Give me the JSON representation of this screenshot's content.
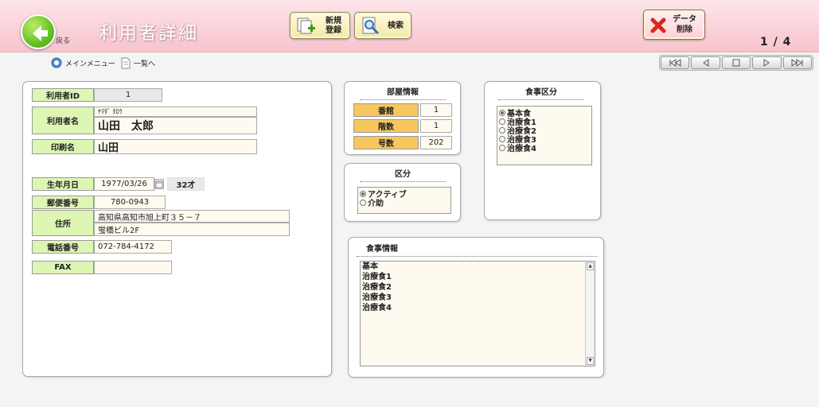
{
  "header": {
    "back_label": "戻る",
    "title": "利用者詳細",
    "new_button": [
      "新規",
      "登録"
    ],
    "search_button": "検索",
    "delete_button": [
      "データ",
      "削除"
    ],
    "page_counter": "1 / 4"
  },
  "subnav": {
    "main_menu": "メインメニュー",
    "list": "一覧へ"
  },
  "user": {
    "id_label": "利用者ID",
    "id_value": "1",
    "name_label": "利用者名",
    "name_kana": "ﾔﾏﾀﾞ ﾀﾛｳ",
    "name_value": "山田　太郎",
    "print_label": "印刷名",
    "print_value": "山田",
    "birth_label": "生年月日",
    "birth_value": "1977/03/26",
    "age_value": "32才",
    "zip_label": "郵便番号",
    "zip_value": "780-0943",
    "address_label": "住所",
    "address_line1": "高知県高知市旭上町３５－７",
    "address_line2": "蛍橋ビル2F",
    "phone_label": "電話番号",
    "phone_value": "072-784-4172",
    "fax_label": "FAX",
    "fax_value": ""
  },
  "room": {
    "title": "部屋情報",
    "building_label": "番館",
    "building_value": "1",
    "floor_label": "階数",
    "floor_value": "1",
    "number_label": "号数",
    "number_value": "202"
  },
  "category": {
    "title": "区分",
    "options": [
      {
        "label": "アクティブ",
        "selected": true
      },
      {
        "label": "介助",
        "selected": false
      }
    ]
  },
  "meal_type": {
    "title": "食事区分",
    "options": [
      {
        "label": "基本食",
        "selected": true
      },
      {
        "label": "治療食1",
        "selected": false
      },
      {
        "label": "治療食2",
        "selected": false
      },
      {
        "label": "治療食3",
        "selected": false
      },
      {
        "label": "治療食4",
        "selected": false
      }
    ]
  },
  "meal_info": {
    "title": "食事情報",
    "items": [
      "基本",
      "治療食1",
      "治療食2",
      "治療食3",
      "治療食4"
    ]
  },
  "colors": {
    "header_pink": "#fbd2d9",
    "label_green": "#ddf6b4",
    "label_orange": "#f8c65f",
    "field_bg": "#fffaf0"
  }
}
